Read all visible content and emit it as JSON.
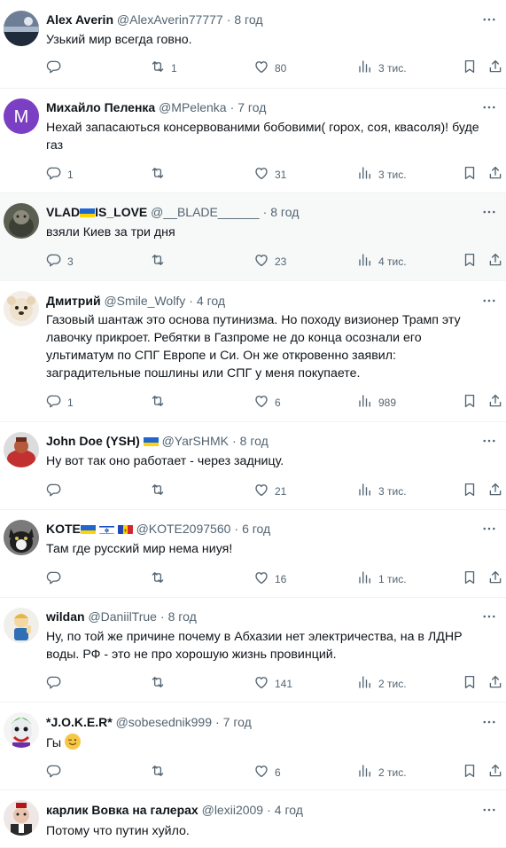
{
  "tweets": [
    {
      "name": "Alex Averin",
      "handle": "@AlexAverin77777",
      "time": "8 год",
      "text": "Узький мир всегда говно.",
      "replies": "",
      "retweets": "1",
      "likes": "80",
      "views": "3 тис."
    },
    {
      "name": "Михайло Пеленка",
      "handle": "@MPelenka",
      "time": "7 год",
      "text": "Нехай запасаються консервованими бобовими( горох, соя, квасоля)! буде газ",
      "replies": "1",
      "retweets": "",
      "likes": "31",
      "views": "3 тис.",
      "avatar_letter": "M"
    },
    {
      "name_prefix": "VLAD",
      "name_suffix": "IS_LOVE",
      "handle": "@__BLADE______",
      "time": "8 год",
      "text": "взяли Киев за три дня",
      "replies": "3",
      "retweets": "",
      "likes": "23",
      "views": "4 тис."
    },
    {
      "name": "Дмитрий",
      "handle": "@Smile_Wolfy",
      "time": "4 год",
      "text": "Газовый шантаж это основа путинизма. Но походу визионер Трамп эту лавочку прикроет. Ребятки в Газпроме не до конца осознали его ультиматум по СПГ Европе и Си. Он же откровенно заявил: заградительные пошлины или СПГ у меня покупаете.",
      "replies": "1",
      "retweets": "",
      "likes": "6",
      "views": "989"
    },
    {
      "name": "John Doe (YSH)",
      "handle": "@YarSHMK",
      "time": "8 год",
      "text": "Ну вот так оно работает - через задницу.",
      "replies": "",
      "retweets": "",
      "likes": "21",
      "views": "3 тис."
    },
    {
      "name": "KOTE",
      "handle": "@KOTE2097560",
      "time": "6 год",
      "text": "Там где русский мир нема ниуя!",
      "replies": "",
      "retweets": "",
      "likes": "16",
      "views": "1 тис."
    },
    {
      "name": "wildan",
      "handle": "@DaniilTrue",
      "time": "8 год",
      "text": "Ну, по той же причине почему в Абхазии нет электричества, на в ЛДНР воды. РФ - это не про хорошую жизнь провинций.",
      "replies": "",
      "retweets": "",
      "likes": "141",
      "views": "2 тис."
    },
    {
      "name": "*J.O.K.E.R*",
      "handle": "@sobesednik999",
      "time": "7 год",
      "text": "Гы",
      "replies": "",
      "retweets": "",
      "likes": "6",
      "views": "2 тис."
    },
    {
      "name": "карлик Вовка на галерах",
      "handle": "@lexii2009",
      "time": "4 год",
      "text": "Потому что путин хуйло.",
      "replies": "",
      "retweets": "",
      "likes": "",
      "views": ""
    }
  ],
  "separator": "·",
  "colors": {
    "text": "#0f1419",
    "secondary": "#536471",
    "border": "#eff3f4",
    "highlight": "#f7f9f9",
    "avatar_purple": "#7b3fc4"
  },
  "icons": [
    "reply-icon",
    "retweet-icon",
    "like-icon",
    "views-icon",
    "bookmark-icon",
    "share-icon",
    "more-icon"
  ]
}
